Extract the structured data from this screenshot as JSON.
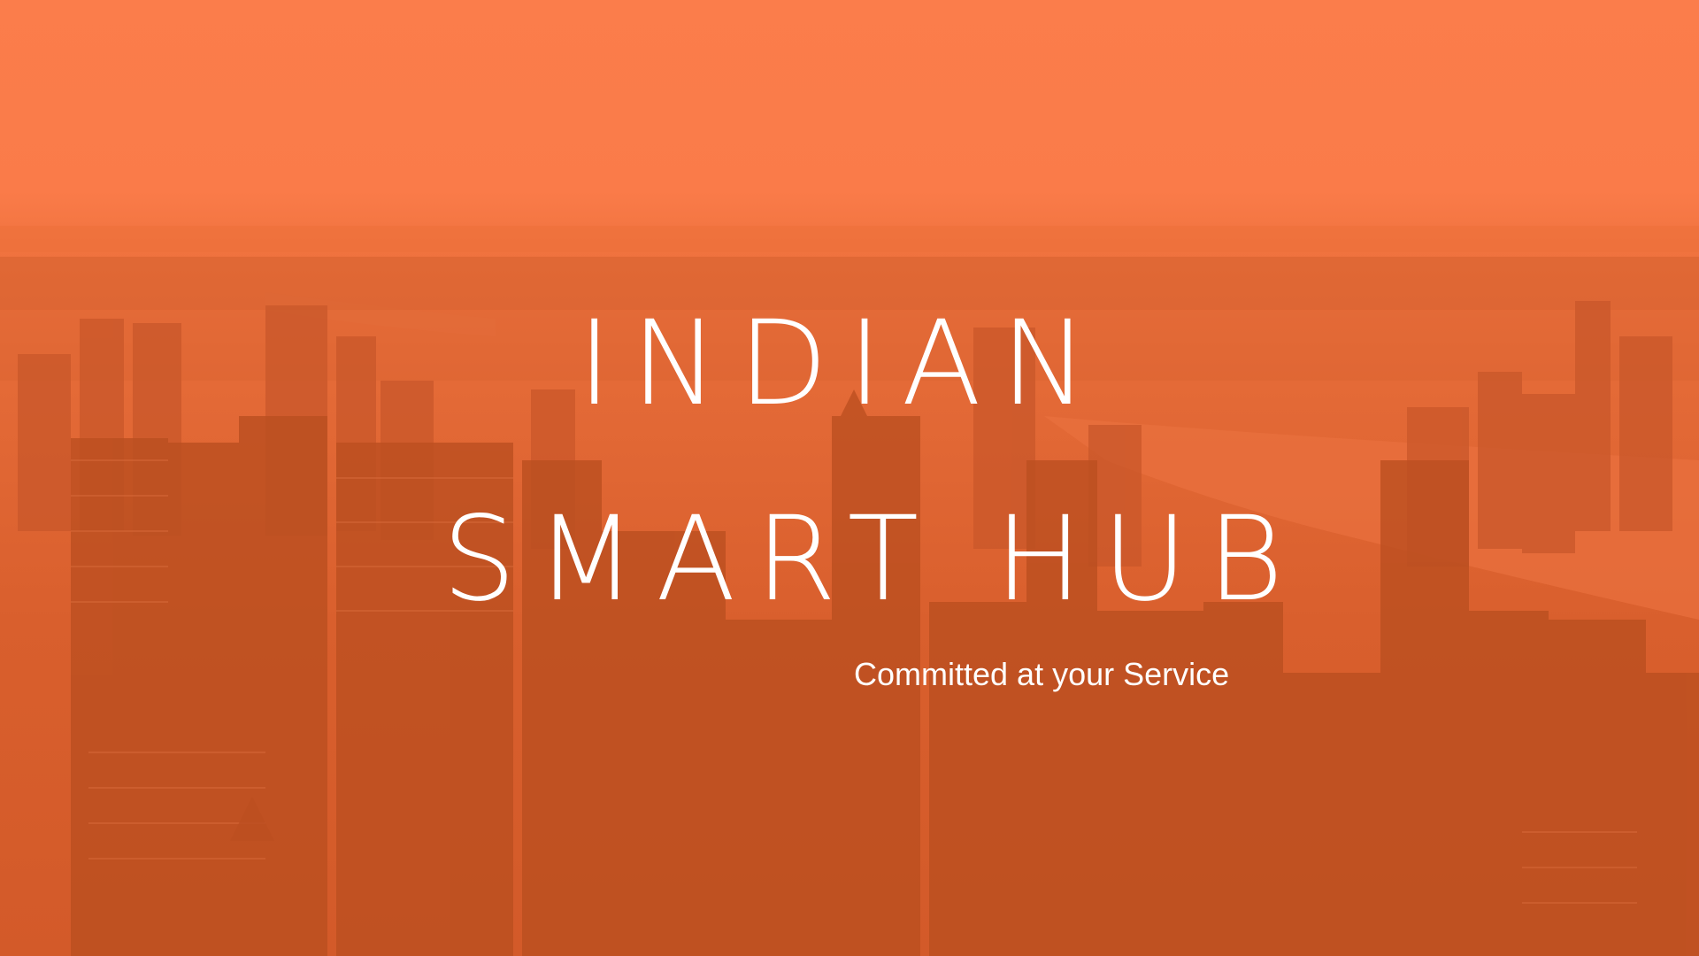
{
  "banner": {
    "title_line1": "INDIAN",
    "title_line2": "SMART HUB",
    "tagline": "Committed at your Service"
  },
  "colors": {
    "overlay_orange": "#fb7d4b",
    "deep_orange": "#d35a29",
    "building_dark": "#b9501f",
    "text": "#ffffff"
  }
}
